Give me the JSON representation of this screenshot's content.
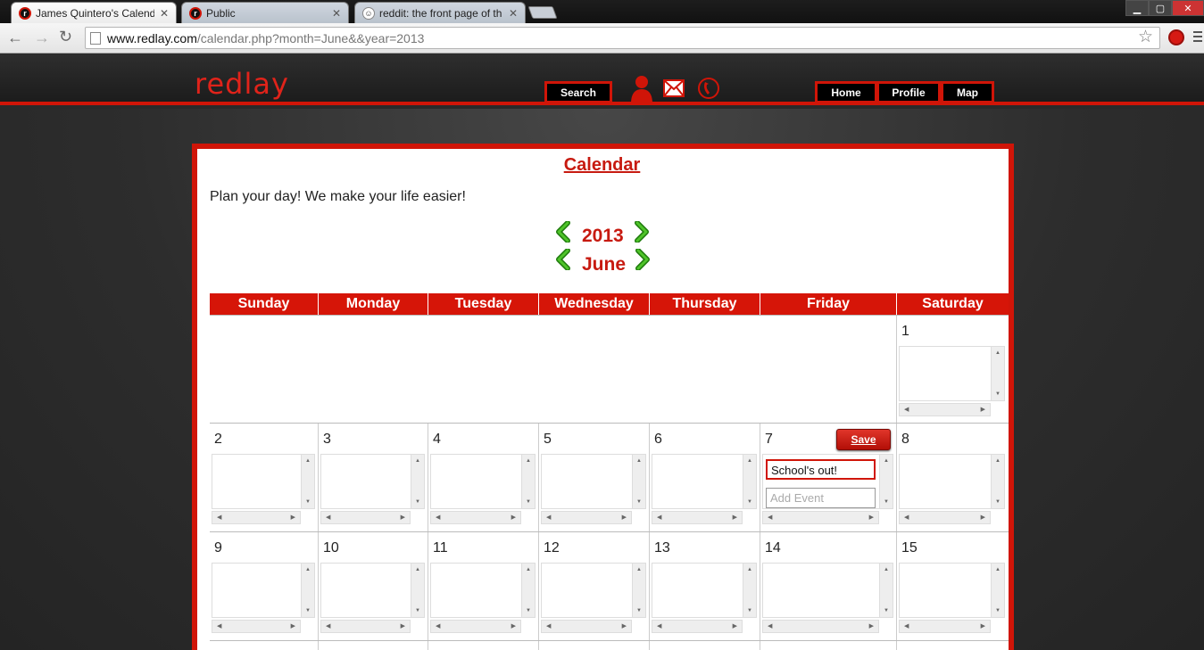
{
  "browser": {
    "tabs": [
      {
        "title": "James Quintero's Calenda",
        "favicon": "redlay-icon",
        "active": true
      },
      {
        "title": "Public",
        "favicon": "redlay-icon",
        "active": false
      },
      {
        "title": "reddit: the front page of th",
        "favicon": "reddit-icon",
        "active": false
      }
    ],
    "url_host": "www.redlay.com",
    "url_path": "/calendar.php?month=June&&year=2013",
    "close_glyph": "✕"
  },
  "site": {
    "logo": "redlay",
    "search_label": "Search",
    "nav": [
      "Home",
      "Profile",
      "Map"
    ],
    "icons": [
      "person-icon",
      "mail-icon",
      "phone-icon"
    ]
  },
  "calendar": {
    "title": "Calendar",
    "tagline": "Plan your day! We make your life easier!",
    "year": "2013",
    "month": "June",
    "weekdays": [
      "Sunday",
      "Monday",
      "Tuesday",
      "Wednesday",
      "Thursday",
      "Friday",
      "Saturday"
    ],
    "weeks": [
      [
        "",
        "",
        "",
        "",
        "",
        "",
        "1"
      ],
      [
        "2",
        "3",
        "4",
        "5",
        "6",
        "7",
        "8"
      ],
      [
        "9",
        "10",
        "11",
        "12",
        "13",
        "14",
        "15"
      ],
      [
        "",
        "",
        "",
        "",
        "",
        "",
        ""
      ]
    ],
    "edit_cell": {
      "day": "7",
      "event_value": "School's out!",
      "add_placeholder": "Add Event",
      "save_label": "Save"
    }
  },
  "colors": {
    "brand_red": "#d01508",
    "chevron_green": "#3aa51c"
  }
}
